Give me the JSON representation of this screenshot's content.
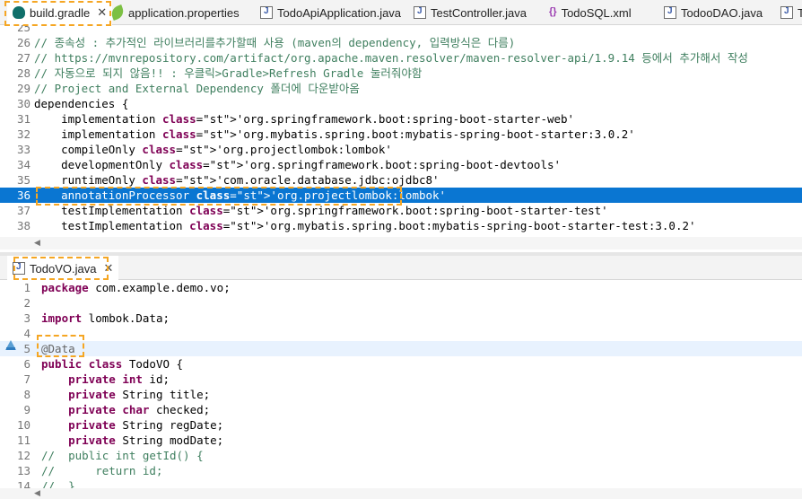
{
  "top_tabs": [
    {
      "label": "build.gradle",
      "icon": "gradle-icon",
      "active": true,
      "closable": true
    },
    {
      "label": "application.properties",
      "icon": "properties-leaf-icon"
    },
    {
      "label": "TodoApiApplication.java",
      "icon": "java-file-icon"
    },
    {
      "label": "TestController.java",
      "icon": "java-file-icon"
    },
    {
      "label": "TodoSQL.xml",
      "icon": "xml-file-icon"
    },
    {
      "label": "TodooDAO.java",
      "icon": "java-file-icon"
    },
    {
      "label": "T",
      "icon": "java-file-icon"
    }
  ],
  "gradle_editor": {
    "lines": [
      {
        "n": "25",
        "text": ""
      },
      {
        "n": "26",
        "text": "// 종속성 : 추가적인 라이브러리를추가할때 사용 (maven의 dependency, 입력방식은 다름)"
      },
      {
        "n": "27",
        "text": "// https://mvnrepository.com/artifact/org.apache.maven.resolver/maven-resolver-api/1.9.14 등에서 추가해서 작성"
      },
      {
        "n": "28",
        "text": "// 자동으로 되지 않음!! : 우클릭>Gradle>Refresh Gradle 눌러줘야함"
      },
      {
        "n": "29",
        "text": "// Project and External Dependency 폴더에 다운받아옴"
      },
      {
        "n": "30",
        "text": "dependencies {"
      },
      {
        "n": "31",
        "text": "    implementation 'org.springframework.boot:spring-boot-starter-web'"
      },
      {
        "n": "32",
        "text": "    implementation 'org.mybatis.spring.boot:mybatis-spring-boot-starter:3.0.2'"
      },
      {
        "n": "33",
        "text": "    compileOnly 'org.projectlombok:lombok'"
      },
      {
        "n": "34",
        "text": "    developmentOnly 'org.springframework.boot:spring-boot-devtools'"
      },
      {
        "n": "35",
        "text": "    runtimeOnly 'com.oracle.database.jdbc:ojdbc8'"
      },
      {
        "n": "36",
        "text": "    annotationProcessor 'org.projectlombok:lombok'"
      },
      {
        "n": "37",
        "text": "    testImplementation 'org.springframework.boot:spring-boot-starter-test'"
      },
      {
        "n": "38",
        "text": "    testImplementation 'org.mybatis.spring.boot:mybatis-spring-boot-starter-test:3.0.2'"
      }
    ],
    "selected_line": "36"
  },
  "vo_tab": {
    "label": "TodoVO.java",
    "icon": "java-file-icon",
    "closable": true
  },
  "vo_editor": {
    "lines": [
      {
        "n": "1",
        "text": "package com.example.demo.vo;"
      },
      {
        "n": "2",
        "text": ""
      },
      {
        "n": "3",
        "text": "import lombok.Data;"
      },
      {
        "n": "4",
        "text": ""
      },
      {
        "n": "5",
        "text": "@Data"
      },
      {
        "n": "6",
        "text": "public class TodoVO {"
      },
      {
        "n": "7",
        "text": "    private int id;"
      },
      {
        "n": "8",
        "text": "    private String title;"
      },
      {
        "n": "9",
        "text": "    private char checked;"
      },
      {
        "n": "10",
        "text": "    private String regDate;"
      },
      {
        "n": "11",
        "text": "    private String modDate;"
      },
      {
        "n": "12",
        "text": "//  public int getId() {"
      },
      {
        "n": "13",
        "text": "//      return id;"
      },
      {
        "n": "14",
        "text": "//  }"
      }
    ],
    "highlighted_line": "5"
  },
  "colors": {
    "selection": "#0a76d2",
    "highlight_box": "#f5a623",
    "comment": "#3f7f5f",
    "keyword": "#7f0055",
    "string": "#2a00ff"
  }
}
